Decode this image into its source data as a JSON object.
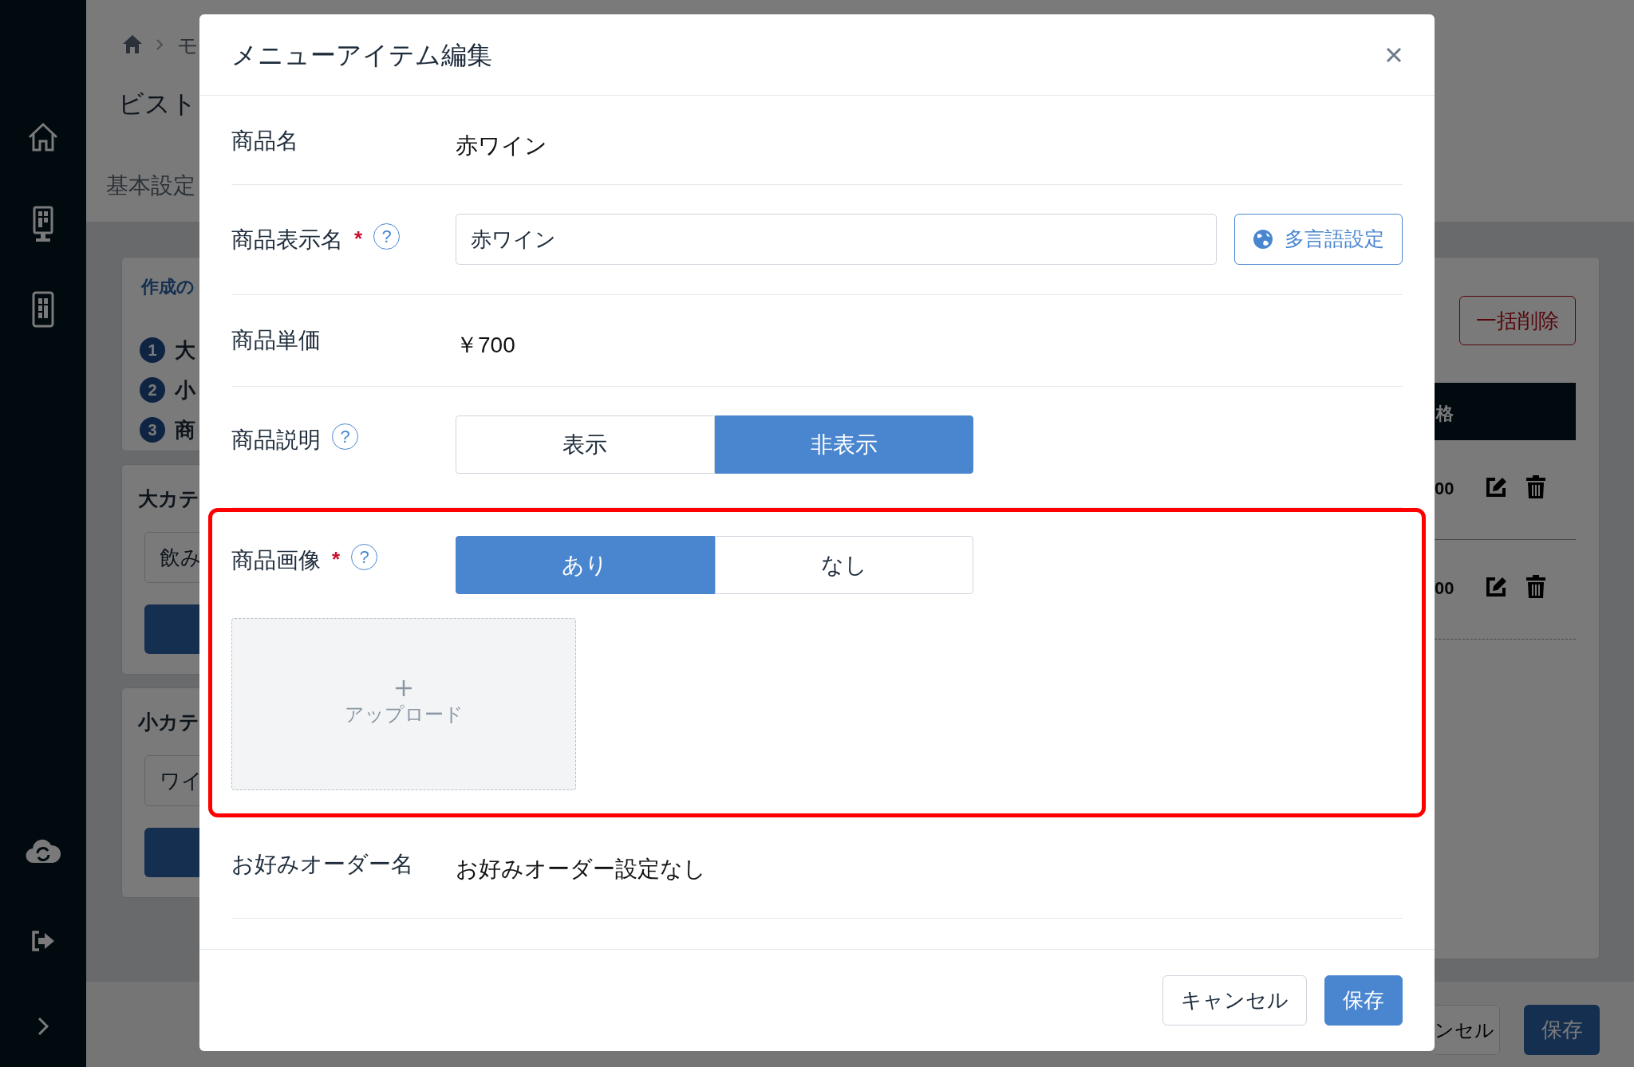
{
  "background_page": {
    "breadcrumb": "モ",
    "title": "ビスト",
    "tab": "基本設定",
    "steps_card": {
      "title": "作成の",
      "steps": [
        {
          "number": "1",
          "label": "大"
        },
        {
          "number": "2",
          "label": "小"
        },
        {
          "number": "3",
          "label": "商"
        }
      ]
    },
    "category_cards": [
      {
        "title": "大カテ",
        "select_value": "飲み"
      },
      {
        "title": "小カテ",
        "select_value": "ワイ"
      }
    ],
    "bulk_delete_button": "一括削除",
    "table": {
      "header": "格",
      "rows": [
        {
          "price": "00"
        },
        {
          "price": "00"
        }
      ]
    },
    "footer": {
      "cancel": "ンセル",
      "save": "保存"
    }
  },
  "modal": {
    "title": "メニューアイテム編集",
    "fields": [
      {
        "kind": "text",
        "label": "商品名",
        "value": "赤ワイン"
      },
      {
        "kind": "input",
        "label": "商品表示名",
        "required_mark": "*",
        "help": "?",
        "value": "赤ワイン",
        "button": "多言語設定"
      },
      {
        "kind": "text",
        "label": "商品単価",
        "value": "￥700"
      },
      {
        "kind": "toggle",
        "label": "商品説明",
        "help": "?",
        "options": [
          {
            "label": "表示",
            "selected": false
          },
          {
            "label": "非表示",
            "selected": true
          }
        ]
      },
      {
        "kind": "toggle",
        "label": "商品画像",
        "required_mark": "*",
        "help": "?",
        "highlighted": true,
        "options": [
          {
            "label": "あり",
            "selected": true
          },
          {
            "label": "なし",
            "selected": false
          }
        ],
        "upload": "アップロード"
      },
      {
        "kind": "text",
        "label": "お好みオーダー名",
        "value": "お好みオーダー設定なし"
      }
    ],
    "buttons": [
      {
        "kind": "secondary",
        "label": "キャンセル"
      },
      {
        "kind": "primary",
        "label": "保存"
      }
    ]
  }
}
